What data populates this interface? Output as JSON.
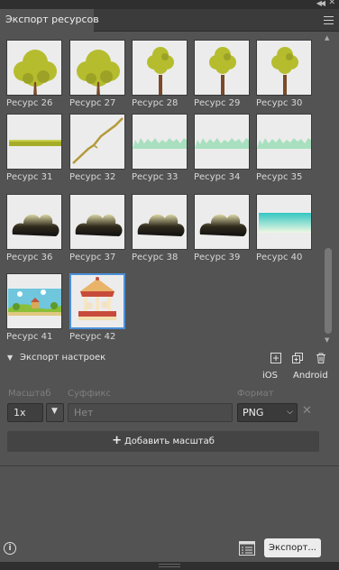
{
  "window": {
    "collapse_glyph": "◀◀",
    "close_glyph": "✕"
  },
  "tab": {
    "title": "Экспорт ресурсов"
  },
  "assets": [
    {
      "label": "Ресурс 26",
      "thumb": "bush-icon"
    },
    {
      "label": "Ресурс 27",
      "thumb": "bush-icon"
    },
    {
      "label": "Ресурс 28",
      "thumb": "tree-icon"
    },
    {
      "label": "Ресурс 29",
      "thumb": "tree-icon"
    },
    {
      "label": "Ресурс 30",
      "thumb": "tree-icon"
    },
    {
      "label": "Ресурс 31",
      "thumb": "grass-strip-icon"
    },
    {
      "label": "Ресурс 32",
      "thumb": "branch-icon"
    },
    {
      "label": "Ресурс 33",
      "thumb": "grass-silhouette-icon"
    },
    {
      "label": "Ресурс 34",
      "thumb": "grass-silhouette-icon"
    },
    {
      "label": "Ресурс 35",
      "thumb": "grass-silhouette-icon"
    },
    {
      "label": "Ресурс 36",
      "thumb": "shrub-shape-icon"
    },
    {
      "label": "Ресурс 37",
      "thumb": "shrub-shape-icon"
    },
    {
      "label": "Ресурс 38",
      "thumb": "shrub-shape-icon"
    },
    {
      "label": "Ресурс 39",
      "thumb": "shrub-shape-icon"
    },
    {
      "label": "Ресурс 40",
      "thumb": "sky-gradient-icon"
    },
    {
      "label": "Ресурс 41",
      "thumb": "landscape-scene-icon"
    },
    {
      "label": "Ресурс 42",
      "thumb": "carousel-icon",
      "selected": true
    }
  ],
  "export_settings": {
    "title": "Экспорт настроек",
    "platform_ios": "iOS",
    "platform_android": "Android",
    "headers": {
      "scale": "Масштаб",
      "suffix": "Суффикс",
      "format": "Формат"
    },
    "scale_value": "1x",
    "suffix_placeholder": "Нет",
    "format_value": "PNG",
    "remove_glyph": "✕",
    "add_scale_plus": "+",
    "add_scale_label": "Добавить масштаб"
  },
  "footer": {
    "info_glyph": "i",
    "export_button": "Экспорт..."
  },
  "colors": {
    "panel": "#535353",
    "selection": "#4a90d9",
    "thumb_bg": "#ececec",
    "foliage": "#b5bd2e"
  }
}
